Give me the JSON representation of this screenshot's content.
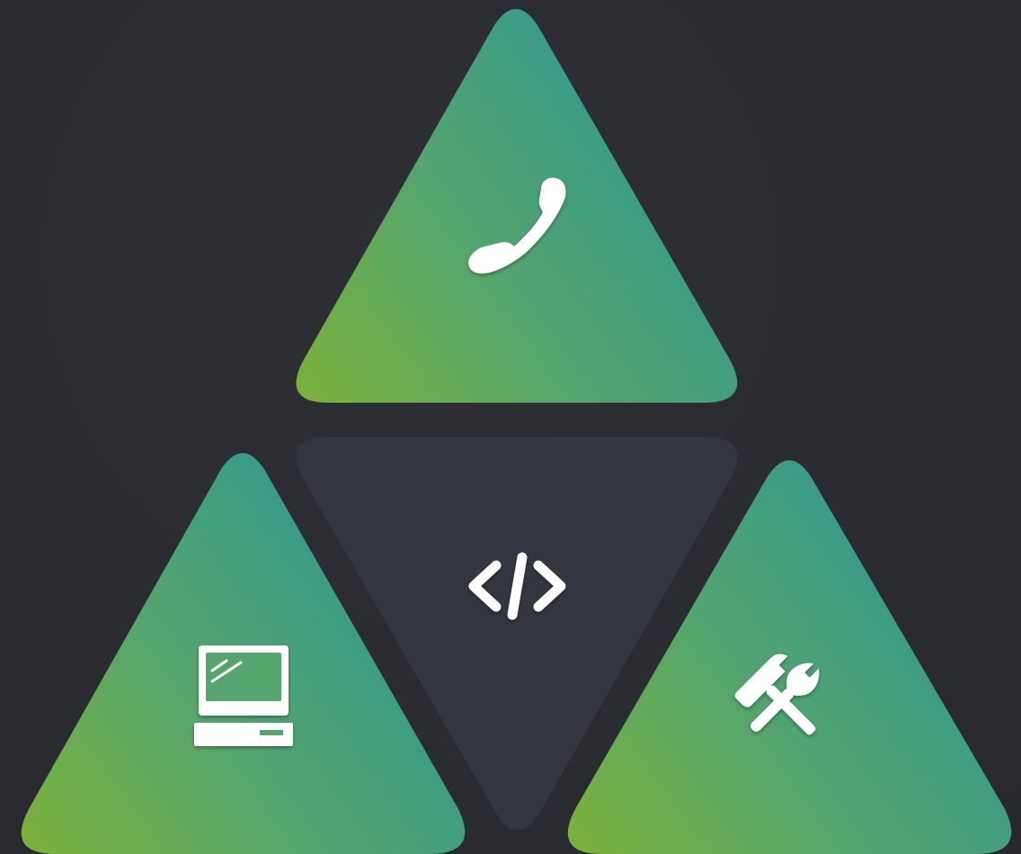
{
  "colors": {
    "background": "#2b2c31",
    "tile_gradient_start": "#7bb23a",
    "tile_gradient_mid": "#4fa574",
    "tile_gradient_end": "#2f9892",
    "center_tile": "#353740",
    "icon": "#ffffff"
  },
  "tiles": [
    {
      "id": "top",
      "icon": "phone-icon",
      "style": "gradient"
    },
    {
      "id": "center",
      "icon": "code-icon",
      "style": "dark"
    },
    {
      "id": "bottom-left",
      "icon": "computer-icon",
      "style": "gradient"
    },
    {
      "id": "bottom-right",
      "icon": "tools-icon",
      "style": "gradient"
    }
  ]
}
